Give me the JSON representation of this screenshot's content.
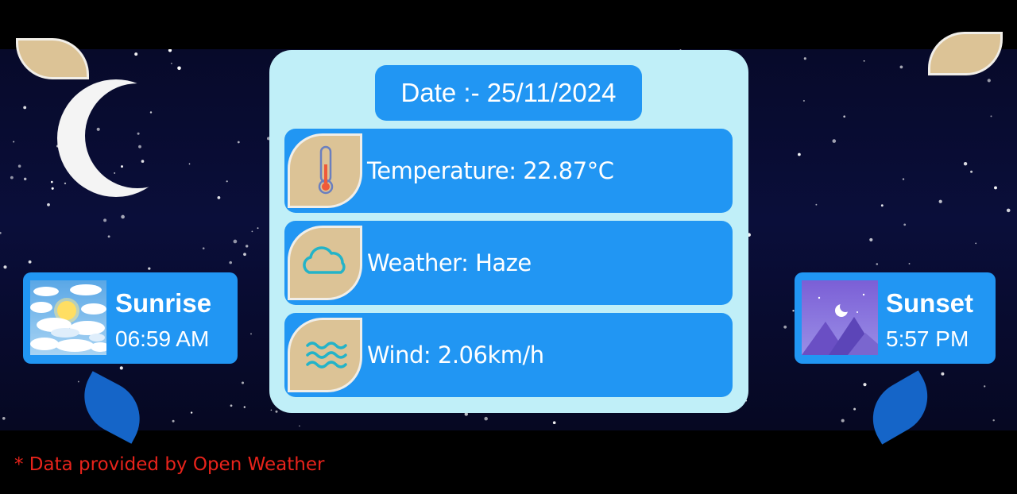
{
  "date": {
    "label": "Date :-",
    "value": "25/11/2024"
  },
  "rows": {
    "temperature": {
      "text": "Temperature: 22.87°C",
      "icon": "thermometer-icon"
    },
    "weather": {
      "text": "Weather: Haze",
      "icon": "cloud-icon"
    },
    "wind": {
      "text": "Wind: 2.06km/h",
      "icon": "waves-icon"
    }
  },
  "sunrise": {
    "title": "Sunrise",
    "time": "06:59 AM",
    "icon": "sunrise-sky-icon"
  },
  "sunset": {
    "title": "Sunset",
    "time": "5:57 PM",
    "icon": "sunset-moon-icon"
  },
  "footnote": "* Data provided by Open Weather",
  "colors": {
    "card_blue": "#2196f3",
    "panel_bg": "#c0eff8",
    "leaf_tan": "#dcc396",
    "drop_blue": "#1565c8",
    "footnote_red": "#e8231b",
    "icon_teal": "#23b3c8"
  }
}
